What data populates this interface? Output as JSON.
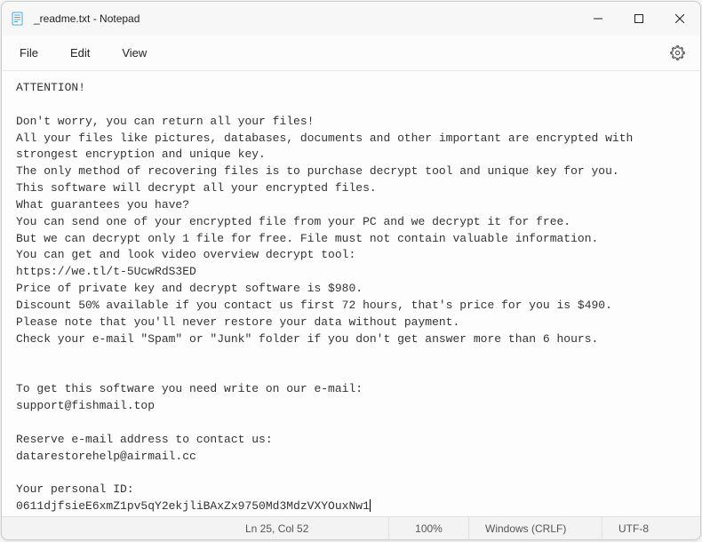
{
  "window": {
    "title": "_readme.txt - Notepad"
  },
  "menu": {
    "file": "File",
    "edit": "Edit",
    "view": "View"
  },
  "content": {
    "lines": [
      "ATTENTION!",
      "",
      "Don't worry, you can return all your files!",
      "All your files like pictures, databases, documents and other important are encrypted with",
      "strongest encryption and unique key.",
      "The only method of recovering files is to purchase decrypt tool and unique key for you.",
      "This software will decrypt all your encrypted files.",
      "What guarantees you have?",
      "You can send one of your encrypted file from your PC and we decrypt it for free.",
      "But we can decrypt only 1 file for free. File must not contain valuable information.",
      "You can get and look video overview decrypt tool:",
      "https://we.tl/t-5UcwRdS3ED",
      "Price of private key and decrypt software is $980.",
      "Discount 50% available if you contact us first 72 hours, that's price for you is $490.",
      "Please note that you'll never restore your data without payment.",
      "Check your e-mail \"Spam\" or \"Junk\" folder if you don't get answer more than 6 hours.",
      "",
      "",
      "To get this software you need write on our e-mail:",
      "support@fishmail.top",
      "",
      "Reserve e-mail address to contact us:",
      "datarestorehelp@airmail.cc",
      "",
      "Your personal ID:",
      "0611djfsieE6xmZ1pv5qY2ekjliBAxZx9750Md3MdzVXYOuxNw1"
    ]
  },
  "status": {
    "position": "Ln 25, Col 52",
    "zoom": "100%",
    "lineending": "Windows (CRLF)",
    "encoding": "UTF-8"
  }
}
